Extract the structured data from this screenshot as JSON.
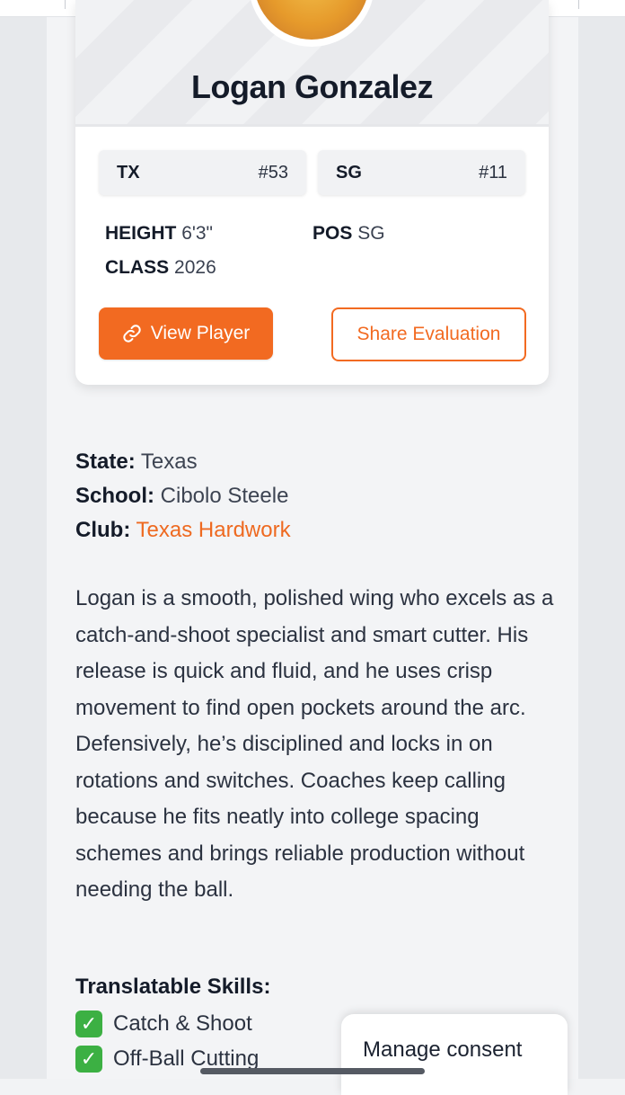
{
  "player": {
    "name": "Logan Gonzalez",
    "tags": [
      {
        "key": "TX",
        "value": "#53"
      },
      {
        "key": "SG",
        "value": "#11"
      }
    ],
    "stats": {
      "height_label": "HEIGHT",
      "height_value": "6'3\"",
      "pos_label": "POS",
      "pos_value": "SG",
      "class_label": "CLASS",
      "class_value": "2026"
    },
    "buttons": {
      "view_player": "View Player",
      "share_evaluation": "Share Evaluation"
    }
  },
  "info": {
    "state_label": "State:",
    "state_value": "Texas",
    "school_label": "School:",
    "school_value": "Cibolo Steele",
    "club_label": "Club:",
    "club_value": "Texas Hardwork"
  },
  "bio": "Logan is a smooth, polished wing who excels as a catch-and-shoot specialist and smart cutter. His release is quick and fluid, and he uses crisp movement to find open pockets around the arc. Defensively, he’s disciplined and locks in on rotations and switches. Coaches keep calling because he fits neatly into college spacing schemes and brings reliable production without needing the ball.",
  "skills": {
    "title": "Translatable Skills:",
    "items": [
      "Catch & Shoot",
      "Off-Ball Cutting"
    ]
  },
  "consent": {
    "label": "Manage consent"
  },
  "colors": {
    "accent": "#f26a21",
    "check": "#3cb043"
  },
  "icons": {
    "view_player": "link-icon",
    "skill_check": "check-mark-icon"
  }
}
